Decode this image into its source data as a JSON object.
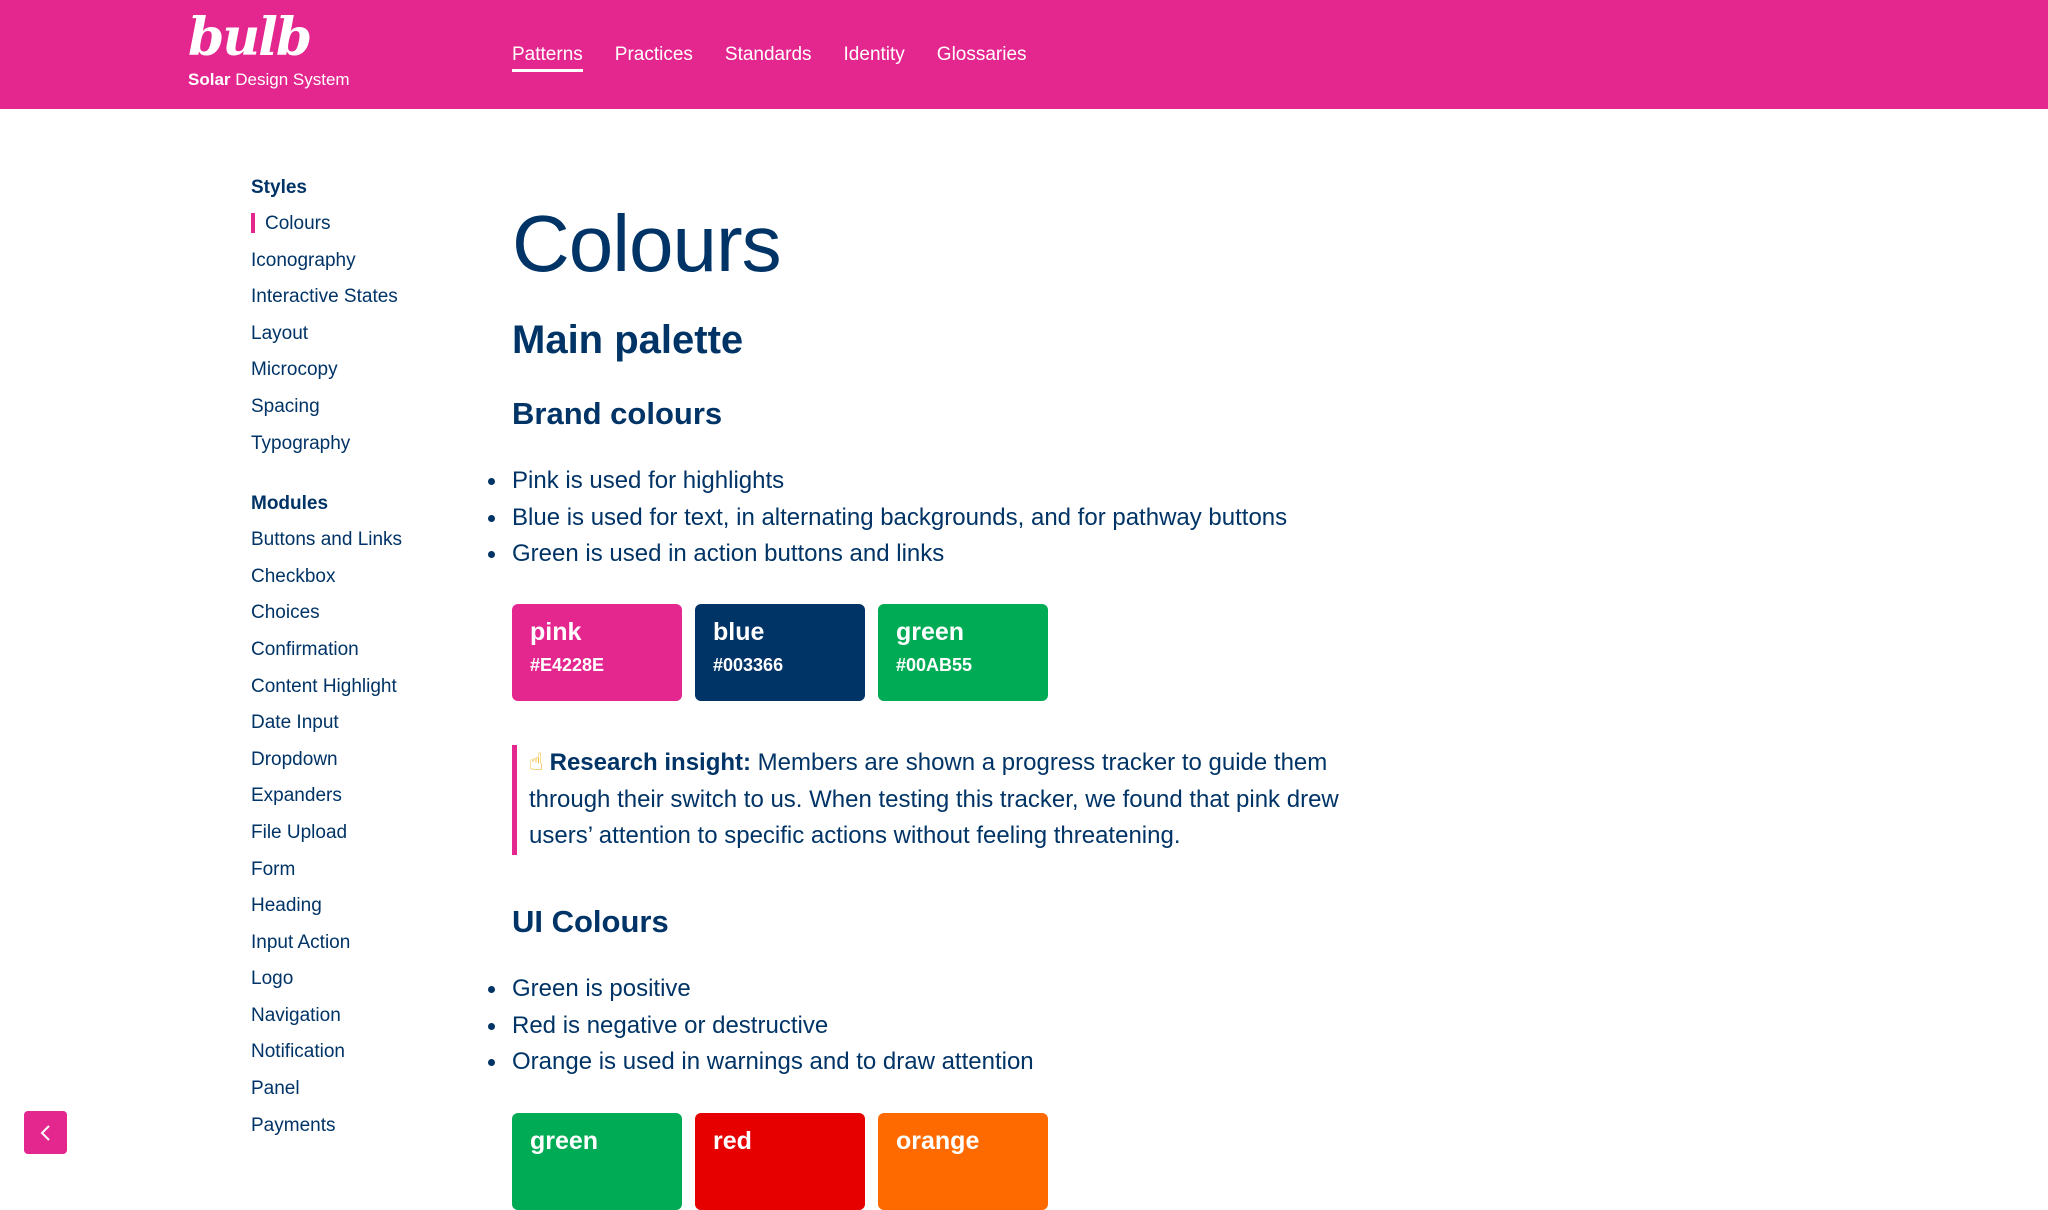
{
  "brand": {
    "logo_text": "bulb",
    "sub_bold": "Solar",
    "sub_rest": " Design System"
  },
  "nav": {
    "items": [
      {
        "label": "Patterns",
        "active": true
      },
      {
        "label": "Practices"
      },
      {
        "label": "Standards"
      },
      {
        "label": "Identity"
      },
      {
        "label": "Glossaries"
      }
    ]
  },
  "sidebar": {
    "styles_heading": "Styles",
    "styles": [
      "Colours",
      "Iconography",
      "Interactive States",
      "Layout",
      "Microcopy",
      "Spacing",
      "Typography"
    ],
    "modules_heading": "Modules",
    "modules": [
      "Buttons and Links",
      "Checkbox",
      "Choices",
      "Confirmation",
      "Content Highlight",
      "Date Input",
      "Dropdown",
      "Expanders",
      "File Upload",
      "Form",
      "Heading",
      "Input Action",
      "Logo",
      "Navigation",
      "Notification",
      "Panel",
      "Payments"
    ]
  },
  "content": {
    "title": "Colours",
    "main_palette": "Main palette",
    "brand_heading": "Brand colours",
    "brand_list": [
      "Pink is used for highlights",
      "Blue is used for text, in alternating backgrounds, and for pathway buttons",
      "Green is used in action buttons and links"
    ],
    "brand_swatches": [
      {
        "name": "pink",
        "hex": "#E4228E",
        "color": "#e4268f"
      },
      {
        "name": "blue",
        "hex": "#003366",
        "color": "#003366"
      },
      {
        "name": "green",
        "hex": "#00AB55",
        "color": "#00ab55"
      }
    ],
    "insight": {
      "icon": "pointing-finger-icon",
      "label": "Research insight:",
      "line1": " Members are shown a progress tracker to guide them",
      "line2": "through their switch to us. When testing this tracker, we found that pink drew",
      "line3": "users’ attention to specific actions without feeling threatening."
    },
    "ui_heading": "UI Colours",
    "ui_list": [
      "Green is positive",
      "Red is negative or destructive",
      "Orange is used in warnings and to draw attention"
    ],
    "ui_swatches": [
      {
        "name": "green",
        "color": "#00ab55"
      },
      {
        "name": "red",
        "color": "#e60000"
      },
      {
        "name": "orange",
        "color": "#ff6a00"
      }
    ]
  },
  "collapse_icon": "chevron-left-icon"
}
